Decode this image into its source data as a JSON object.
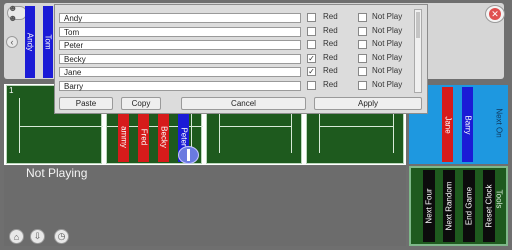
{
  "top_players": [
    "Andy",
    "Tom"
  ],
  "dialog": {
    "players": [
      {
        "name": "Andy",
        "red": false,
        "not_play": false
      },
      {
        "name": "Tom",
        "red": false,
        "not_play": false
      },
      {
        "name": "Peter",
        "red": false,
        "not_play": false
      },
      {
        "name": "Becky",
        "red": true,
        "not_play": false
      },
      {
        "name": "Jane",
        "red": true,
        "not_play": false
      },
      {
        "name": "Barry",
        "red": false,
        "not_play": false
      }
    ],
    "red_label": "Red",
    "not_play_label": "Not Play",
    "buttons": {
      "paste": "Paste",
      "copy": "Copy",
      "cancel": "Cancel",
      "apply": "Apply"
    }
  },
  "court1": {
    "number": "1",
    "players": [
      "ammy",
      "Fred",
      "Becky",
      "Peter"
    ],
    "colors": [
      "#d61b1b",
      "#d61b1b",
      "#d61b1b",
      "#1b1bd6"
    ]
  },
  "next_on": {
    "label": "Next On",
    "players": [
      "Jane",
      "Barry"
    ],
    "colors": [
      "#d61b1b",
      "#1b1bd6"
    ]
  },
  "not_playing": {
    "title": "Not Playing"
  },
  "tools": {
    "label": "Tools",
    "buttons": [
      "Next Four",
      "Next Random",
      "End Game",
      "Reset Clock"
    ]
  },
  "colors": {
    "blue": "#1b1bd6",
    "red": "#d61b1b",
    "court_green": "#1e5a1e",
    "next_on_blue": "#1e98e0"
  }
}
